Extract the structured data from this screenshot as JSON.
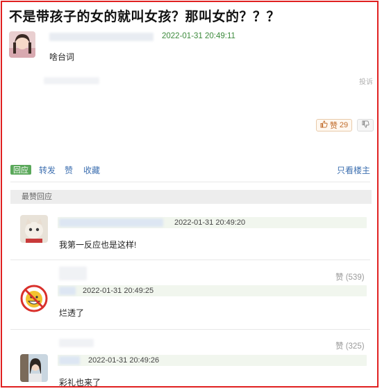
{
  "post": {
    "title": "不是带孩子的女的就叫女孩？那叫女的？？？",
    "timestamp": "2022-01-31 20:49:11",
    "body": "啥台词",
    "report": "投诉",
    "like_label": "赞",
    "like_count": "29"
  },
  "actions": {
    "reply": "回应",
    "repost": "转发",
    "like": "赞",
    "collect": "收藏",
    "only_op": "只看楼主"
  },
  "section": {
    "label": "最赞回应"
  },
  "comments": [
    {
      "timestamp": "2022-01-31 20:49:20",
      "text": "我第一反应也是这样!",
      "likes": ""
    },
    {
      "timestamp": "2022-01-31 20:49:25",
      "text": "烂透了",
      "likes": "赞 (539)"
    },
    {
      "timestamp": "2022-01-31 20:49:26",
      "text": "彩礼也来了",
      "likes": "赞 (325)"
    }
  ],
  "colors": {
    "frame": "#e02020",
    "timestamp_green": "#3b8a3b",
    "link_blue": "#3d6fb0",
    "reply_badge": "#5aa85a"
  }
}
